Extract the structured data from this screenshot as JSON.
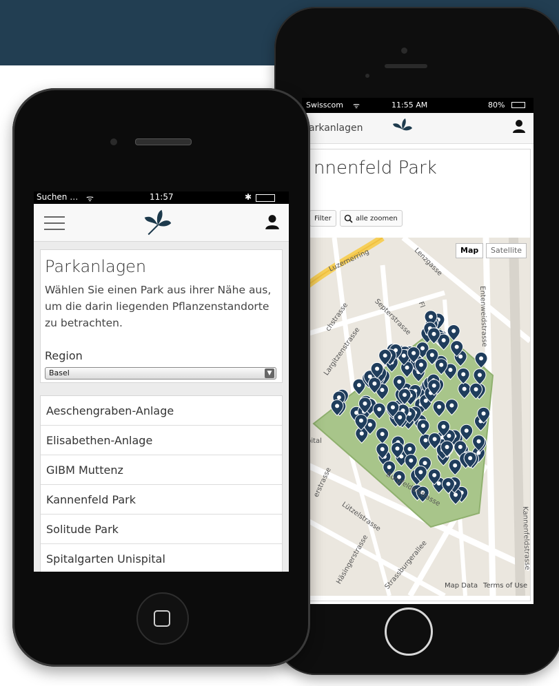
{
  "left_phone": {
    "status": {
      "carrier": "Suchen …",
      "time": "11:57"
    },
    "header": {
      "menu_icon": "hamburger-menu-icon",
      "logo_icon": "leaf-logo-icon",
      "user_icon": "user-icon"
    },
    "page": {
      "title": "Parkanlagen",
      "description": "Wählen Sie einen Park aus ihrer Nähe aus, um die darin liegenden Pflanzenstandorte zu betrachten.",
      "region_label": "Region",
      "region_value": "Basel"
    },
    "parks": [
      "Aeschengraben-Anlage",
      "Elisabethen-Anlage",
      "GIBM Muttenz",
      "Kannenfeld Park",
      "Solitude Park",
      "Spitalgarten Unispital"
    ]
  },
  "right_phone": {
    "status": {
      "carrier": "Swisscom",
      "time": "11:55 AM",
      "battery": "80%"
    },
    "header": {
      "back_label": "arkanlagen",
      "logo_icon": "leaf-logo-icon",
      "user_icon": "user-icon"
    },
    "page": {
      "title": "nnenfeld Park",
      "filter_label": "Filter",
      "zoom_label": "alle zoomen"
    },
    "map": {
      "type_options": [
        "Map",
        "Satellite"
      ],
      "selected_type": "Map",
      "streets": [
        "Luzernerring",
        "Lenzgasse",
        "Septerstrasse",
        "Largitzenstrasse",
        "Fl",
        "Burgfelderstrasse",
        "Lützelstrasse",
        "Häsingerstrasse",
        "Strassburgerallee",
        "Entenweidstrasse",
        "Kannenfeldstrasse",
        "erstrasse",
        "chstrasse",
        "pital"
      ],
      "footer": [
        "Map Data",
        "Terms of Use"
      ],
      "park_color": "#a8c58a",
      "marker_color": "#1f3d5c"
    }
  },
  "colors": {
    "banner": "#223e52"
  }
}
